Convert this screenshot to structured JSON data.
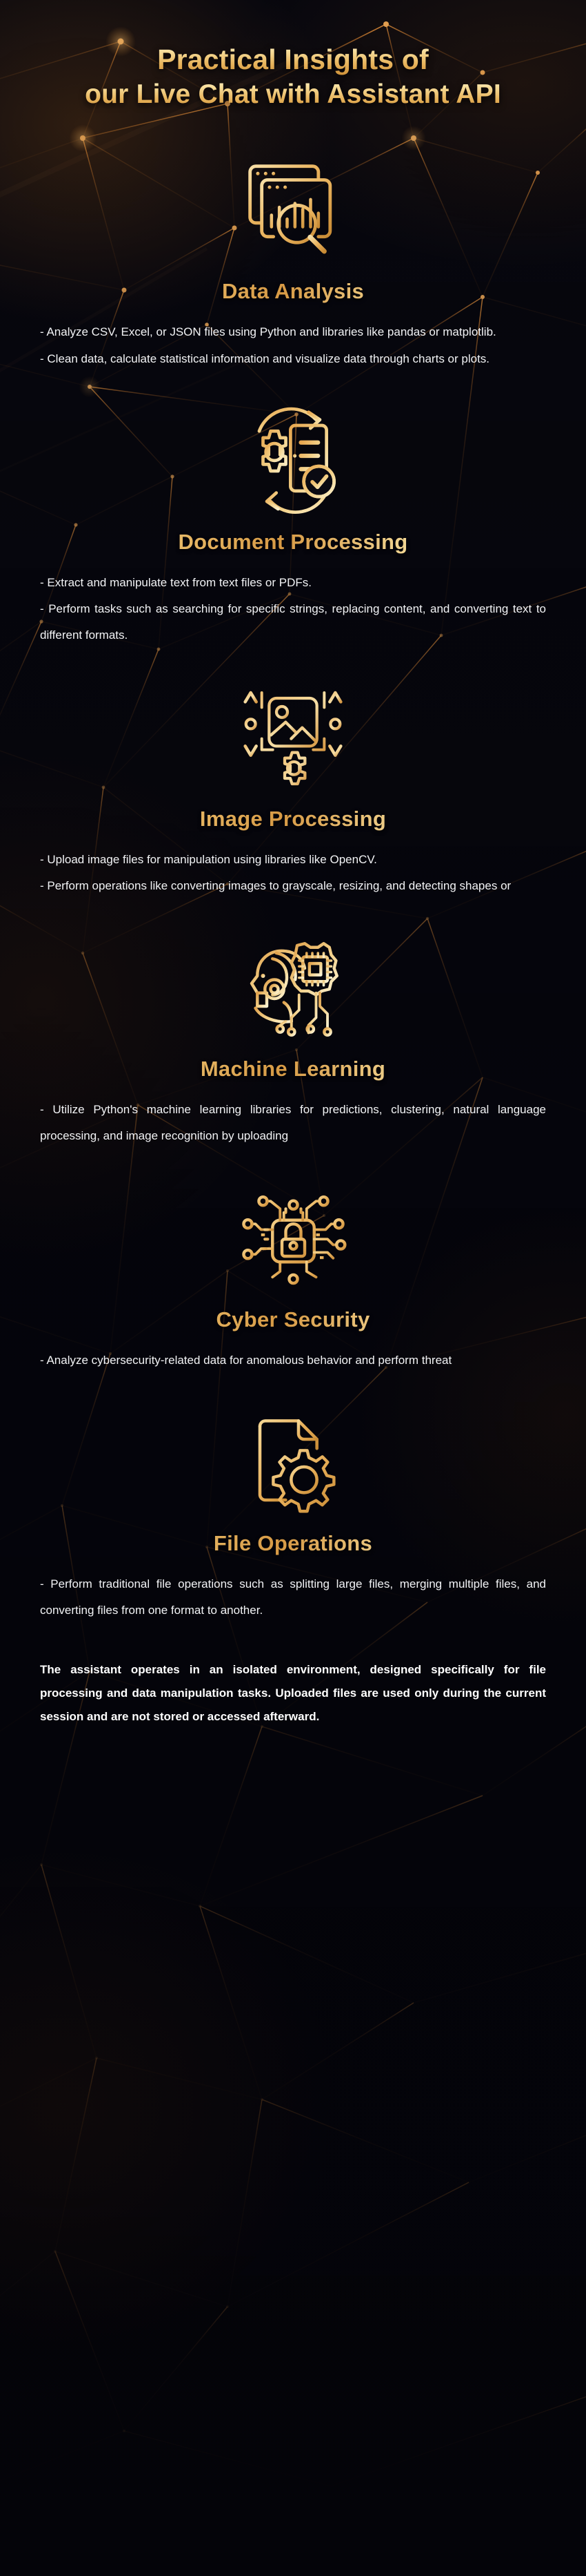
{
  "theme": {
    "background": "#07070e",
    "gold_light": "#fdf3cf",
    "gold": "#e8b45c",
    "gold_dark": "#c98b33",
    "body_text": "#f2f3f5"
  },
  "header": {
    "title_line_1": "Practical Insights of",
    "title_line_2": "our Live Chat with Assistant API"
  },
  "sections": [
    {
      "icon": "data-analysis-icon",
      "heading": "Data Analysis",
      "paragraphs": [
        "- Analyze CSV, Excel, or JSON files using Python and libraries like pandas or matplotlib.",
        "- Clean data, calculate statistical information and visualize data through charts or plots."
      ]
    },
    {
      "icon": "document-processing-icon",
      "heading": "Document Processing",
      "paragraphs": [
        "- Extract and manipulate text from text files or PDFs.",
        "- Perform tasks such as searching for specific strings, replacing content, and converting text to different formats."
      ]
    },
    {
      "icon": "image-processing-icon",
      "heading": "Image Processing",
      "paragraphs": [
        "- Upload image files for manipulation using libraries like OpenCV.",
        "- Perform operations like converting images to grayscale, resizing, and detecting shapes or"
      ]
    },
    {
      "icon": "machine-learning-icon",
      "heading": "Machine Learning",
      "paragraphs": [
        "- Utilize Python's machine learning libraries for predictions, clustering, natural language processing, and image recognition by uploading"
      ]
    },
    {
      "icon": "cyber-security-icon",
      "heading": "Cyber Security",
      "paragraphs": [
        "- Analyze cybersecurity-related data for anomalous behavior and perform threat"
      ]
    },
    {
      "icon": "file-operations-icon",
      "heading": "File Operations",
      "paragraphs": [
        "- Perform traditional file operations such as splitting large files, merging multiple files, and converting files from one format to another."
      ]
    }
  ],
  "footer": {
    "note": "The assistant operates in an isolated environment, designed specifically for file processing and data manipulation tasks. Uploaded files are used only during the current session and are not stored or accessed afterward."
  }
}
